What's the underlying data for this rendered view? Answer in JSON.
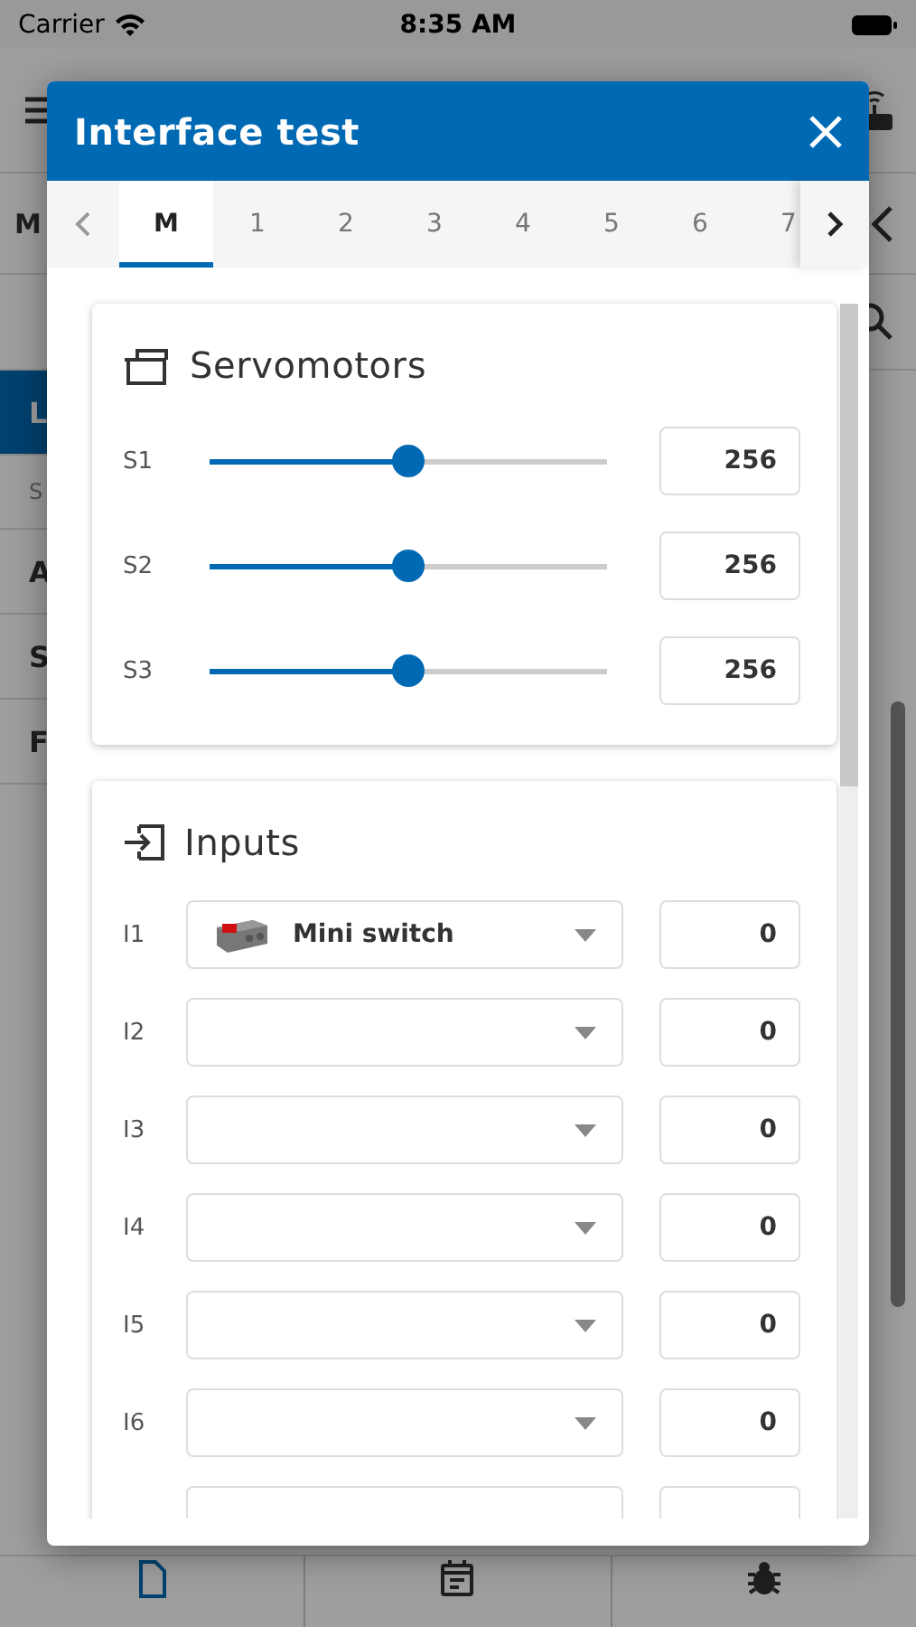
{
  "status_bar": {
    "carrier": "Carrier",
    "time": "8:35 AM"
  },
  "background": {
    "header_letter": "M",
    "sidebar": [
      {
        "label": "L",
        "kind": "item",
        "selected": true
      },
      {
        "label": "S",
        "kind": "caption",
        "selected": false
      },
      {
        "label": "A",
        "kind": "item",
        "selected": false
      },
      {
        "label": "S",
        "kind": "item",
        "selected": false
      },
      {
        "label": "F",
        "kind": "item",
        "selected": false
      }
    ],
    "tab_bar": [
      {
        "kind": "document",
        "selected": true
      },
      {
        "kind": "calendar",
        "selected": false
      },
      {
        "kind": "bug",
        "selected": false
      }
    ]
  },
  "dialog": {
    "title": "Interface test",
    "tabs": [
      {
        "label": "M",
        "selected": true
      },
      {
        "label": "1",
        "selected": false
      },
      {
        "label": "2",
        "selected": false
      },
      {
        "label": "3",
        "selected": false
      },
      {
        "label": "4",
        "selected": false
      },
      {
        "label": "5",
        "selected": false
      },
      {
        "label": "6",
        "selected": false
      },
      {
        "label": "7",
        "selected": false
      }
    ],
    "servos": {
      "title": "Servomotors",
      "rows": [
        {
          "label": "S1",
          "level": 0.5,
          "value": "256"
        },
        {
          "label": "S2",
          "level": 0.5,
          "value": "256"
        },
        {
          "label": "S3",
          "level": 0.5,
          "value": "256"
        }
      ]
    },
    "inputs": {
      "title": "Inputs",
      "rows": [
        {
          "label": "I1",
          "sensor": "Mini switch",
          "value": "0"
        },
        {
          "label": "I2",
          "value": "0"
        },
        {
          "label": "I3",
          "value": "0"
        },
        {
          "label": "I4",
          "value": "0"
        },
        {
          "label": "I5",
          "value": "0"
        },
        {
          "label": "I6",
          "value": "0"
        }
      ]
    }
  }
}
